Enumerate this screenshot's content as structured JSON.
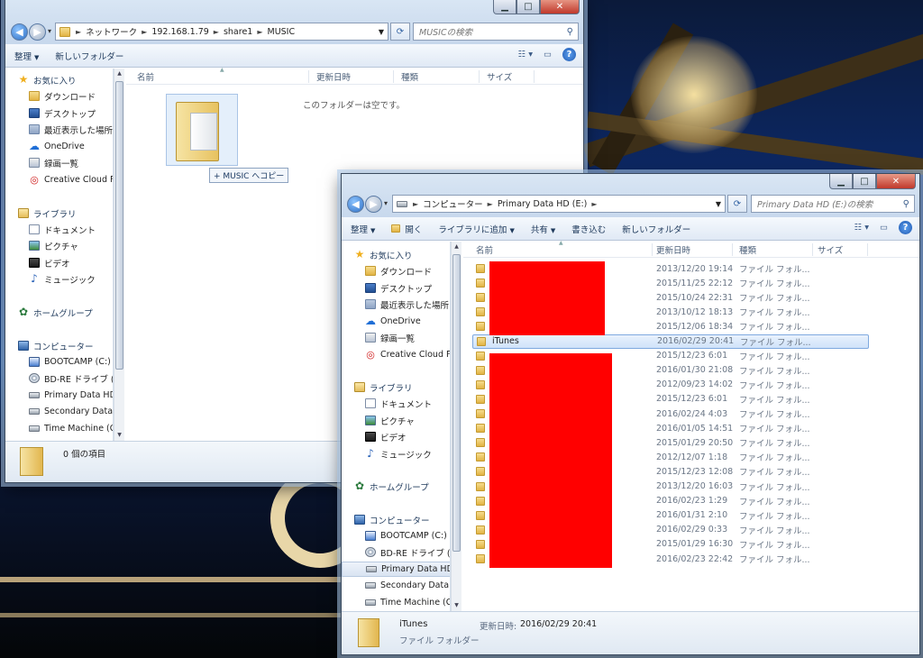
{
  "window1": {
    "caption": {
      "minimize": "▁",
      "maximize": "□",
      "close": "✕"
    },
    "address": {
      "crumbs": [
        "ネットワーク",
        "192.168.1.79",
        "share1",
        "MUSIC"
      ]
    },
    "search_placeholder": "MUSICの検索",
    "toolbar": {
      "organize": "整理",
      "new_folder": "新しいフォルダー"
    },
    "columns": {
      "name": "名前",
      "modified": "更新日時",
      "type": "種類",
      "size": "サイズ"
    },
    "empty_text": "このフォルダーは空です。",
    "drag_tooltip": "+ MUSIC へコピー",
    "nav": {
      "favorites": "お気に入り",
      "favorites_items": [
        "ダウンロード",
        "デスクトップ",
        "最近表示した場所",
        "OneDrive",
        "録画一覧",
        "Creative Cloud Files"
      ],
      "libraries": "ライブラリ",
      "libraries_items": [
        "ドキュメント",
        "ピクチャ",
        "ビデオ",
        "ミュージック"
      ],
      "homegroup": "ホームグループ",
      "computer": "コンピューター",
      "computer_items": [
        "BOOTCAMP (C:)",
        "BD-RE ドライブ (D:)",
        "Primary Data HD (E:)",
        "Secondary Data HD",
        "Time Machine (G:)"
      ]
    },
    "status": {
      "count": "0 個の項目"
    }
  },
  "window2": {
    "caption": {
      "minimize": "▁",
      "maximize": "□",
      "close": "✕"
    },
    "address": {
      "crumbs": [
        "コンピューター",
        "Primary Data HD (E:)"
      ]
    },
    "search_placeholder": "Primary Data HD (E:)の検索",
    "toolbar": {
      "organize": "整理",
      "open": "開く",
      "add_library": "ライブラリに追加",
      "share": "共有",
      "burn": "書き込む",
      "new_folder": "新しいフォルダー"
    },
    "columns": {
      "name": "名前",
      "modified": "更新日時",
      "type": "種類",
      "size": "サイズ"
    },
    "nav": {
      "favorites": "お気に入り",
      "favorites_items": [
        "ダウンロード",
        "デスクトップ",
        "最近表示した場所",
        "OneDrive",
        "録画一覧",
        "Creative Cloud Files"
      ],
      "libraries": "ライブラリ",
      "libraries_items": [
        "ドキュメント",
        "ピクチャ",
        "ビデオ",
        "ミュージック"
      ],
      "homegroup": "ホームグループ",
      "computer": "コンピューター",
      "computer_items": [
        "BOOTCAMP (C:)",
        "BD-RE ドライブ (D:)",
        "Primary Data HD (E:)",
        "Secondary Data HD",
        "Time Machine (G:)"
      ]
    },
    "files": [
      {
        "name": "",
        "date": "2013/12/20 19:14",
        "type": "ファイル フォル..."
      },
      {
        "name": "",
        "date": "2015/11/25 22:12",
        "type": "ファイル フォル..."
      },
      {
        "name": "",
        "date": "2015/10/24 22:31",
        "type": "ファイル フォル..."
      },
      {
        "name": "",
        "date": "2013/10/12 18:13",
        "type": "ファイル フォル..."
      },
      {
        "name": "",
        "date": "2015/12/06 18:34",
        "type": "ファイル フォル..."
      },
      {
        "name": "iTunes",
        "date": "2016/02/29 20:41",
        "type": "ファイル フォル..."
      },
      {
        "name": "",
        "date": "2015/12/23 6:01",
        "type": "ファイル フォル..."
      },
      {
        "name": "",
        "date": "2016/01/30 21:08",
        "type": "ファイル フォル..."
      },
      {
        "name": "",
        "date": "2012/09/23 14:02",
        "type": "ファイル フォル..."
      },
      {
        "name": "",
        "date": "2015/12/23 6:01",
        "type": "ファイル フォル..."
      },
      {
        "name": "",
        "date": "2016/02/24 4:03",
        "type": "ファイル フォル..."
      },
      {
        "name": "",
        "date": "2016/01/05 14:51",
        "type": "ファイル フォル..."
      },
      {
        "name": "",
        "date": "2015/01/29 20:50",
        "type": "ファイル フォル..."
      },
      {
        "name": "",
        "date": "2012/12/07 1:18",
        "type": "ファイル フォル..."
      },
      {
        "name": "",
        "date": "2015/12/23 12:08",
        "type": "ファイル フォル..."
      },
      {
        "name": "",
        "date": "2013/12/20 16:03",
        "type": "ファイル フォル..."
      },
      {
        "name": "",
        "date": "2016/02/23 1:29",
        "type": "ファイル フォル..."
      },
      {
        "name": "",
        "date": "2016/01/31 2:10",
        "type": "ファイル フォル..."
      },
      {
        "name": "",
        "date": "2016/02/29 0:33",
        "type": "ファイル フォル..."
      },
      {
        "name": "",
        "date": "2015/01/29 16:30",
        "type": "ファイル フォル..."
      },
      {
        "name": "",
        "date": "2016/02/23 22:42",
        "type": "ファイル フォル..."
      }
    ],
    "status": {
      "name": "iTunes",
      "modified_label": "更新日時:",
      "modified_value": "2016/02/29 20:41",
      "type": "ファイル フォルダー"
    }
  },
  "colors": {
    "selection": "#cfe2f9",
    "redaction": "#ff0000"
  }
}
